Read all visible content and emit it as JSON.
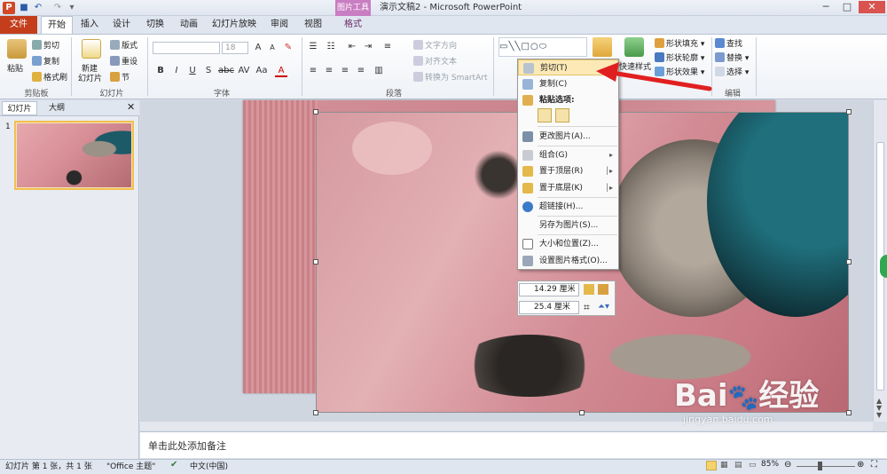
{
  "window": {
    "title": "演示文稿2 - Microsoft PowerPoint",
    "context_tab_group": "图片工具",
    "buttons": [
      "─",
      "□",
      "✕"
    ]
  },
  "tabs": [
    {
      "label": "文件"
    },
    {
      "label": "开始"
    },
    {
      "label": "插入"
    },
    {
      "label": "设计"
    },
    {
      "label": "切换"
    },
    {
      "label": "动画"
    },
    {
      "label": "幻灯片放映"
    },
    {
      "label": "审阅"
    },
    {
      "label": "视图"
    },
    {
      "label": "格式"
    }
  ],
  "ribbon": {
    "clipboard": {
      "label": "剪贴板",
      "paste": "粘贴",
      "cut": "剪切",
      "copy": "复制",
      "format_painter": "格式刷"
    },
    "slides": {
      "label": "幻灯片",
      "new_slide": "新建",
      "new_slide2": "幻灯片",
      "layout": "版式",
      "reset": "重设",
      "section": "节"
    },
    "font": {
      "label": "字体",
      "size": "18"
    },
    "paragraph": {
      "label": "段落",
      "text_direction": "文字方向",
      "align_text": "对齐文本",
      "smartart": "转换为 SmartArt"
    },
    "drawing": {
      "quick_style": "快速样式",
      "fill": "形状填充",
      "outline": "形状轮廓",
      "effect": "形状效果"
    },
    "editing": {
      "label": "编辑",
      "find": "查找",
      "replace": "替换",
      "select": "选择"
    }
  },
  "panel": {
    "tab_slides": "幻灯片",
    "tab_outline": "大纲",
    "slide_number": "1"
  },
  "context_menu": {
    "items": [
      {
        "label": "剪切(T)",
        "icon": "scissors-icon"
      },
      {
        "label": "复制(C)",
        "icon": "copy-icon"
      },
      {
        "label": "粘贴选项:",
        "icon": "paste-icon"
      },
      {
        "label": "更改图片(A)...",
        "icon": "change-picture-icon"
      },
      {
        "label": "组合(G)",
        "icon": "group-icon"
      },
      {
        "label": "置于顶层(R)",
        "icon": "bring-front-icon"
      },
      {
        "label": "置于底层(K)",
        "icon": "send-back-icon"
      },
      {
        "label": "超链接(H)...",
        "icon": "hyperlink-icon"
      },
      {
        "label": "另存为图片(S)...",
        "icon": "save-picture-icon"
      },
      {
        "label": "大小和位置(Z)...",
        "icon": "size-position-icon"
      },
      {
        "label": "设置图片格式(O)...",
        "icon": "format-picture-icon"
      }
    ]
  },
  "mini_toolbar": {
    "height": "14.29 厘米",
    "width": "25.4 厘米"
  },
  "notes_placeholder": "单击此处添加备注",
  "status": {
    "slide_info": "幻灯片 第 1 张，共 1 张",
    "theme": "\"Office 主题\"",
    "language": "中文(中国)",
    "zoom": "85%"
  },
  "watermark": {
    "brand": "Bai",
    "brand2": "经验",
    "url": "jingyan.baidu.com"
  },
  "colors": {
    "file_tab": "#c43e1c",
    "highlight": "#fce9b6",
    "arrow": "#e02020",
    "context_tab": "#c97dc2"
  }
}
